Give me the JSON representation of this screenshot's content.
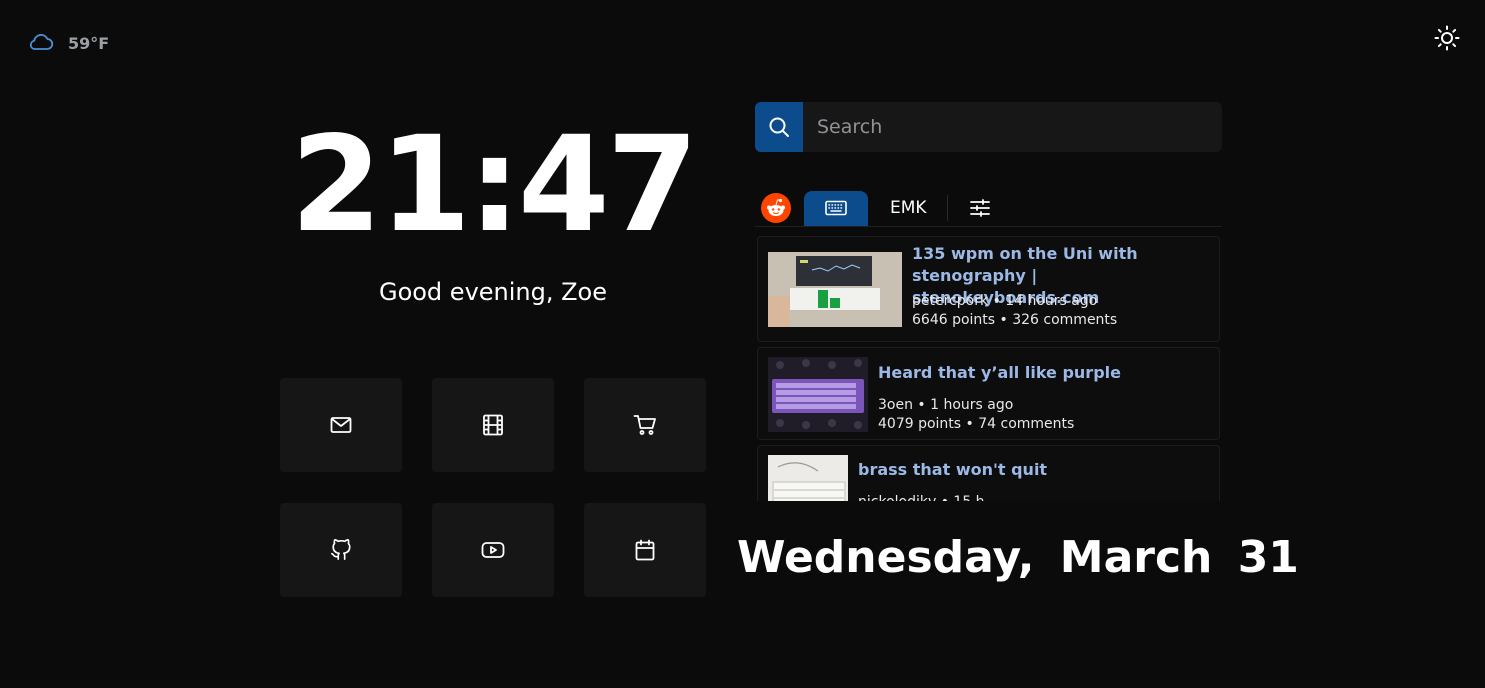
{
  "weather": {
    "temp": "59°F",
    "icon": "cloud-icon"
  },
  "theme_toggle": {
    "icon": "sun-icon"
  },
  "clock": {
    "time": "21:47"
  },
  "greeting": "Good evening, Zoe",
  "shortcuts": [
    {
      "name": "mail",
      "icon": "mail-icon"
    },
    {
      "name": "film",
      "icon": "film-icon"
    },
    {
      "name": "cart",
      "icon": "cart-icon"
    },
    {
      "name": "github",
      "icon": "github-icon"
    },
    {
      "name": "youtube",
      "icon": "youtube-icon"
    },
    {
      "name": "calendar",
      "icon": "calendar-icon"
    }
  ],
  "search": {
    "placeholder": "Search",
    "icon": "search-icon"
  },
  "feed_tabs": {
    "reddit_icon": "reddit-icon",
    "keyboard_icon": "keyboard-icon",
    "emk_label": "EMK",
    "settings_icon": "sliders-icon"
  },
  "posts": [
    {
      "title": "135 wpm on the Uni with stenography | stenokeyboards.com",
      "author_time": "petercpork • 14 hours ago",
      "stats": "6646 points • 326 comments"
    },
    {
      "title": "Heard that y’all like purple",
      "author_time": "3oen • 1 hours ago",
      "stats": "4079 points • 74 comments"
    },
    {
      "title": "brass that won't quit",
      "author_time": "nickolodikv • 15 h",
      "stats": ""
    }
  ],
  "date": "Wednesday, March 31",
  "colors": {
    "accent": "#0d4c8c",
    "reddit": "#ff4500",
    "link": "#9cb9e6",
    "tile": "#161617"
  }
}
